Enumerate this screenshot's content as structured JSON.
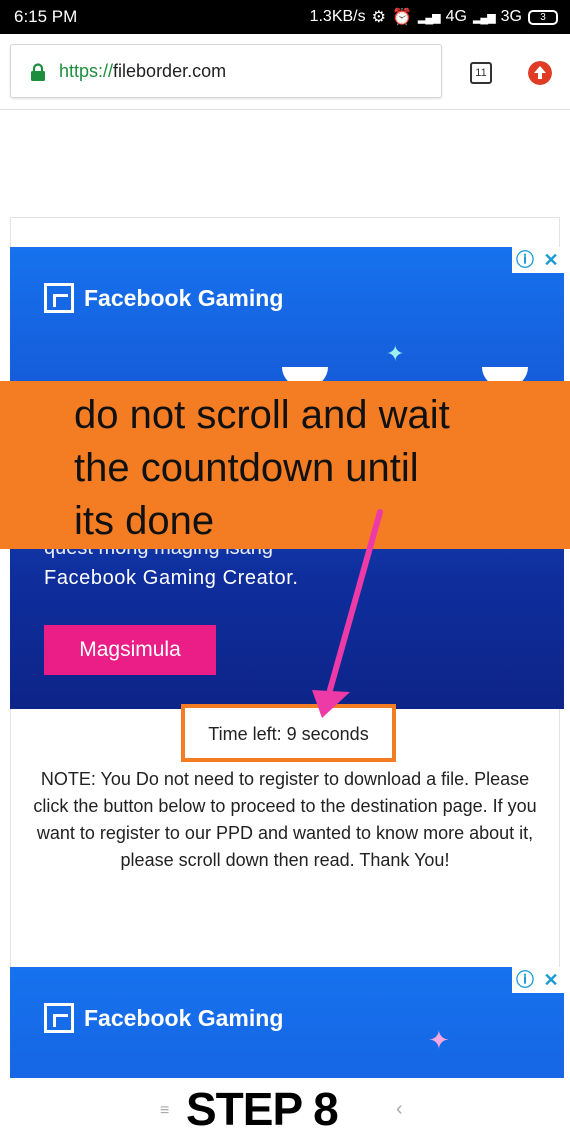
{
  "status_bar": {
    "time": "6:15 PM",
    "network_speed": "1.3KB/s",
    "net1": "4G",
    "net2": "3G",
    "battery": "3"
  },
  "browser": {
    "url_scheme": "https://",
    "url_host": "fileborder.com",
    "tab_count": "11"
  },
  "ad_top": {
    "brand": "Facebook Gaming",
    "body_line1": "quest mong maging isang",
    "body_line2": "Facebook Gaming Creator.",
    "cta": "Magsimula",
    "info_icon": "info-icon",
    "close_icon": "close-icon"
  },
  "annotation": {
    "line1": "do not scroll and wait",
    "line2": "the countdown until",
    "line3": "its done",
    "banner_color": "#f47d23",
    "arrow_color": "#ee3aa6"
  },
  "countdown": {
    "text": "Time left: 9 seconds"
  },
  "note": {
    "text": "NOTE: You Do not need to register to download a file. Please click the button below to proceed to the destination page. If you want to register to our PPD and wanted to know more about it, please scroll down then read. Thank You!"
  },
  "ad_bottom": {
    "brand": "Facebook Gaming"
  },
  "step": {
    "label": "STEP 8"
  }
}
